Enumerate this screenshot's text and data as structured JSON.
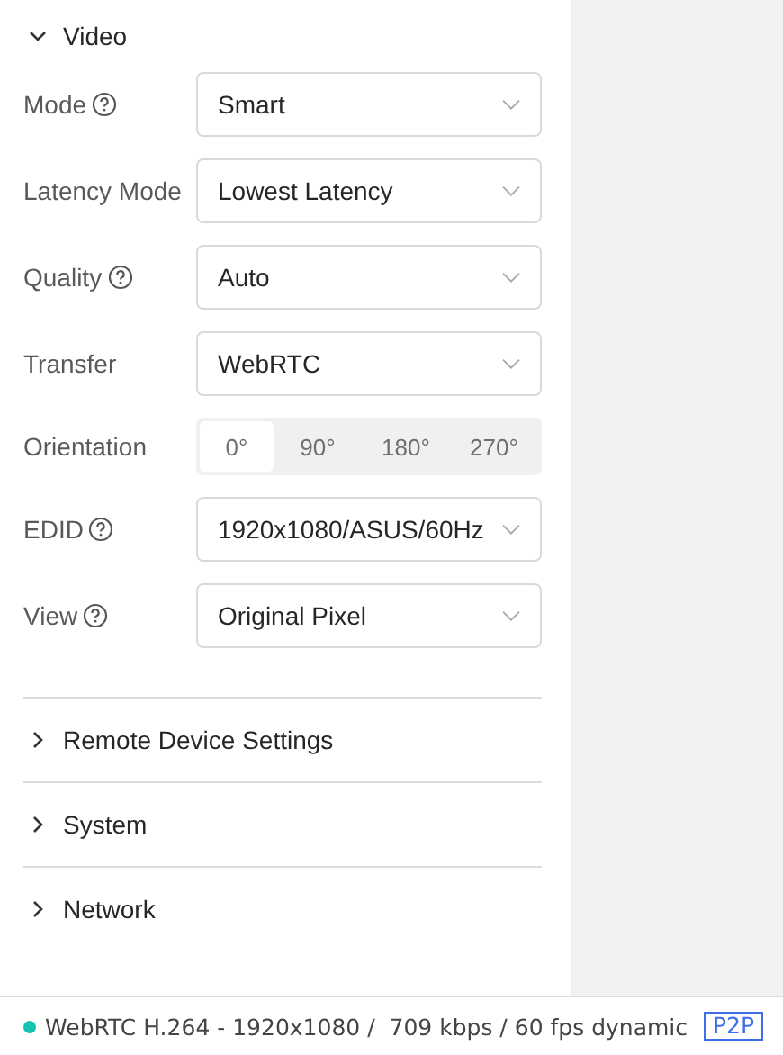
{
  "sections": [
    {
      "title": "Video",
      "expanded": true,
      "fields": [
        {
          "kind": "select",
          "label": "Mode",
          "help": true,
          "value": "Smart"
        },
        {
          "kind": "select",
          "label": "Latency Mode",
          "help": false,
          "value": "Lowest Latency"
        },
        {
          "kind": "select",
          "label": "Quality",
          "help": true,
          "value": "Auto"
        },
        {
          "kind": "select",
          "label": "Transfer",
          "help": false,
          "value": "WebRTC"
        },
        {
          "kind": "segmented",
          "label": "Orientation",
          "help": false,
          "options": [
            {
              "label": "0°",
              "selected": true
            },
            {
              "label": "90°",
              "selected": false
            },
            {
              "label": "180°",
              "selected": false
            },
            {
              "label": "270°",
              "selected": false
            }
          ]
        },
        {
          "kind": "select",
          "label": "EDID",
          "help": true,
          "value": "1920x1080/ASUS/60Hz"
        },
        {
          "kind": "select",
          "label": "View",
          "help": true,
          "value": "Original Pixel"
        }
      ]
    },
    {
      "title": "Remote Device Settings",
      "expanded": false
    },
    {
      "title": "System",
      "expanded": false
    },
    {
      "title": "Network",
      "expanded": false
    }
  ],
  "status_bar": {
    "color": "#13c2b3",
    "text": "WebRTC H.264 - 1920x1080 /  709 kbps / 60 fps dynamic",
    "badge": "P2P"
  }
}
